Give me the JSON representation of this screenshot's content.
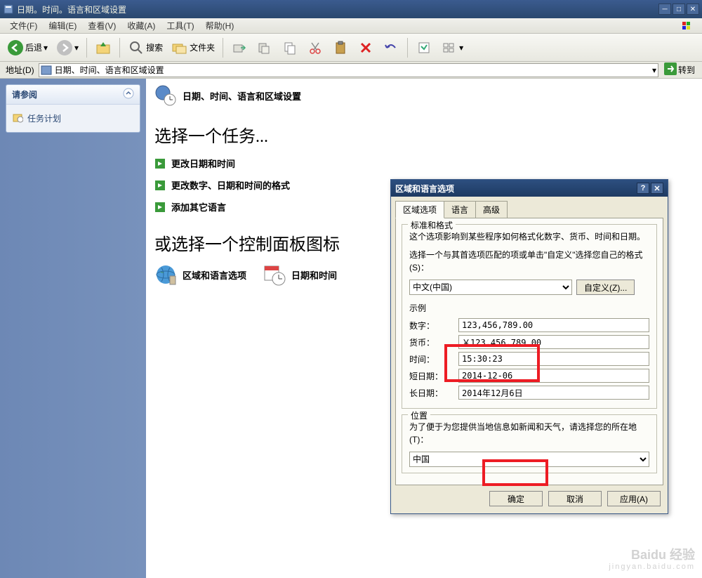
{
  "window": {
    "title": "日期。时间。语言和区域设置"
  },
  "menu": {
    "file": "文件(F)",
    "edit": "编辑(E)",
    "view": "查看(V)",
    "favorites": "收藏(A)",
    "tools": "工具(T)",
    "help": "帮助(H)"
  },
  "toolbar": {
    "back": "后退",
    "search": "搜索",
    "folders": "文件夹"
  },
  "address": {
    "label": "地址(D)",
    "value": "日期、时间、语言和区域设置",
    "go": "转到"
  },
  "sidebar": {
    "header": "请参阅",
    "items": [
      {
        "label": "任务计划"
      }
    ]
  },
  "main": {
    "header": "日期、时间、语言和区域设置",
    "section1": "选择一个任务...",
    "tasks": [
      {
        "label": "更改日期和时间"
      },
      {
        "label": "更改数字、日期和时间的格式"
      },
      {
        "label": "添加其它语言"
      }
    ],
    "section2": "或选择一个控制面板图标",
    "cpicons": [
      {
        "label": "区域和语言选项"
      },
      {
        "label": "日期和时间"
      }
    ]
  },
  "dialog": {
    "title": "区域和语言选项",
    "tabs": {
      "regional": "区域选项",
      "language": "语言",
      "advanced": "高级"
    },
    "standards": {
      "legend": "标准和格式",
      "desc1": "这个选项影响到某些程序如何格式化数字、货币、时间和日期。",
      "desc2": "选择一个与其首选项匹配的项或单击\"自定义\"选择您自己的格式(S)：",
      "locale": "中文(中国)",
      "customize": "自定义(Z)...",
      "samples_label": "示例",
      "number_label": "数字：",
      "number_value": "123,456,789.00",
      "currency_label": "货币：",
      "currency_value": "￥123,456,789.00",
      "time_label": "时间：",
      "time_value": "15:30:23",
      "shortdate_label": "短日期：",
      "shortdate_value": "2014-12-06",
      "longdate_label": "长日期：",
      "longdate_value": "2014年12月6日"
    },
    "location": {
      "legend": "位置",
      "desc": "为了便于为您提供当地信息如新闻和天气，请选择您的所在地(T)：",
      "value": "中国"
    },
    "buttons": {
      "ok": "确定",
      "cancel": "取消",
      "apply": "应用(A)"
    }
  },
  "watermark": {
    "line1": "Baidu 经验",
    "line2": "jingyan.baidu.com"
  }
}
